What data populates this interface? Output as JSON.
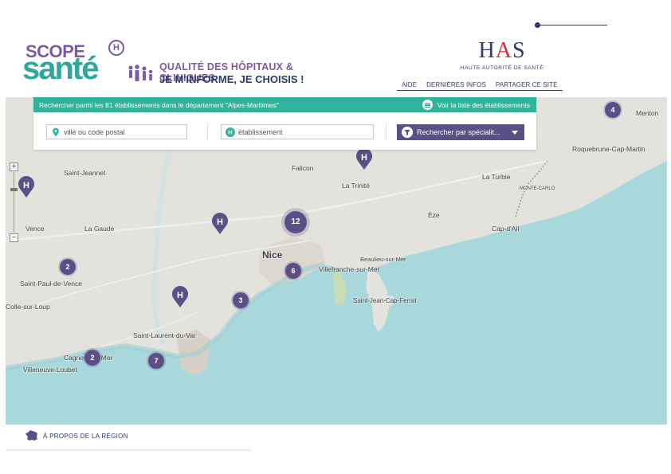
{
  "header": {
    "logo": {
      "scope": "SCOPE",
      "sante": "santé",
      "badge": "H",
      "tagline_1": "QUALITÉ DES HÔPITAUX & CLINIQUES",
      "tagline_2": "JE M'INFORME, JE CHOISIS !"
    },
    "has_logo": {
      "mark_1": "H",
      "mark_2": "A",
      "mark_3": "S",
      "subtitle": "HAUTE AUTORITÉ DE SANTÉ"
    },
    "nav": [
      "AIDE",
      "DERNIÈRES INFOS",
      "PARTAGER CE SITE"
    ]
  },
  "search_panel": {
    "banner_text": "Rechercher parmi les 81 établissements dans le département \"Alpes-Maritimes\"",
    "list_link": "Voir la liste des établissements",
    "city_placeholder": "ville ou code postal",
    "etablissement_placeholder": "établissement",
    "specialite_button": "Rechercher par spécialit..."
  },
  "map": {
    "zoom_in": "+",
    "zoom_out": "−",
    "labels": {
      "menton": "Menton",
      "roquebrune": "Roquebrune-Cap-Martin",
      "la_turbie": "La Turbie",
      "monte_carlo": "MONTE-CARLO",
      "eze": "Èze",
      "cap_dail": "Cap-d'Ail",
      "saint_jeannet": "Saint-Jeannet",
      "falicon": "Falicon",
      "la_trinite": "La Trinité",
      "vence": "Vence",
      "la_gaude": "La Gaude",
      "nice": "Nice",
      "beaulieu": "Beaulieu-sur-Mer",
      "villefranche": "Villefranche-sur-Mer",
      "saint_paul": "Saint-Paul-de-Vence",
      "colle": "Colle-sur-Loup",
      "saint_jean": "Saint-Jean-Cap-Ferrat",
      "saint_laurent": "Saint-Laurent-du-Var",
      "cagnes": "Cagnes-sur-Mer",
      "villeneuve": "Villeneuve-Loubet"
    },
    "clusters": {
      "menton": "4",
      "nice_north": "12",
      "nice_center": "6",
      "nice_west": "3",
      "saint_paul": "2",
      "cagnes": "2",
      "saint_laurent": "7"
    },
    "pin_label": "H"
  },
  "footer": {
    "region_link": "À PROPOS DE LA RÉGION"
  },
  "colors": {
    "primary_purple": "#5a4f86",
    "teal": "#2fb39c",
    "navy": "#2b3a6b",
    "sea": "#a9d8dc"
  }
}
